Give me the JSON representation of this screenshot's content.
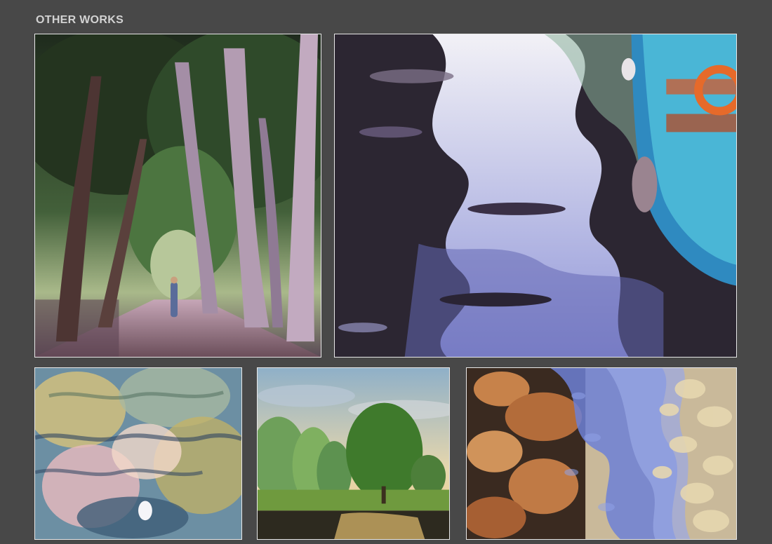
{
  "section": {
    "title": "OTHER WORKS"
  },
  "works": [
    {
      "id": "tree-avenue",
      "palette": [
        "#2b3a2a",
        "#5d7a4a",
        "#8a6a8c",
        "#b9a3b5"
      ]
    },
    {
      "id": "boat-reflections",
      "palette": [
        "#2a2630",
        "#6c6fb6",
        "#eef0f7",
        "#3f8fb5"
      ]
    },
    {
      "id": "water-light",
      "palette": [
        "#6c8fa3",
        "#d8c27a",
        "#e9b6c1",
        "#2e4460"
      ]
    },
    {
      "id": "river-trees",
      "palette": [
        "#8fb0c8",
        "#3f7a2c",
        "#e7c98a",
        "#2d2a1f"
      ]
    },
    {
      "id": "stream-rocks",
      "palette": [
        "#c7824a",
        "#6d80d6",
        "#e6d7b0",
        "#3a2a20"
      ]
    }
  ]
}
